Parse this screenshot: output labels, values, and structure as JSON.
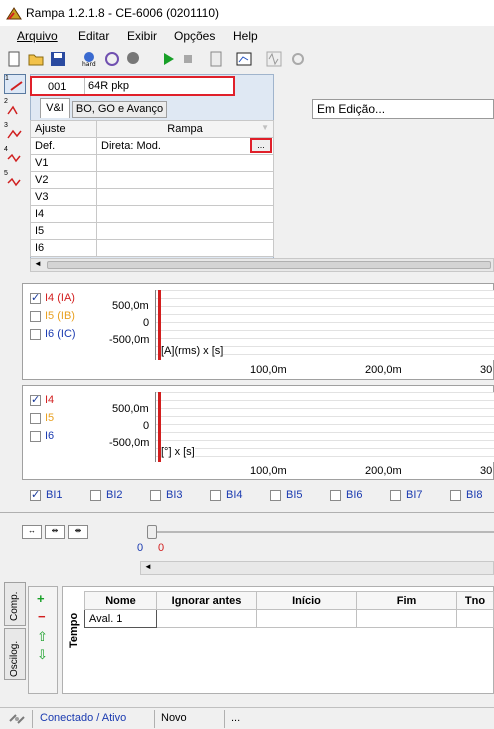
{
  "window": {
    "title": "Rampa 1.2.1.8 - CE-6006 (0201110)"
  },
  "menu": [
    "Arquivo",
    "Editar",
    "Exibir",
    "Opções",
    "Help"
  ],
  "toolbar": {
    "mode_combo": "Em Edição..."
  },
  "step_nav": [
    "1",
    "2",
    "3",
    "4",
    "5"
  ],
  "step": {
    "number": "001",
    "name": "64R pkp",
    "tabs": [
      "V&I",
      "BO, GO e Avanço"
    ]
  },
  "grid": {
    "col_ajuste": "Ajuste",
    "col_rampa": "Rampa",
    "rows": [
      {
        "name": "Def.",
        "value": "Direta: Mod."
      },
      {
        "name": "V1",
        "value": ""
      },
      {
        "name": "V2",
        "value": ""
      },
      {
        "name": "V3",
        "value": ""
      },
      {
        "name": "I4",
        "value": ""
      },
      {
        "name": "I5",
        "value": ""
      },
      {
        "name": "I6",
        "value": ""
      }
    ],
    "ellipsis": "..."
  },
  "plot1": {
    "series": [
      {
        "label": "I4 (IA)",
        "color": "#d21e1e",
        "checked": true
      },
      {
        "label": "I5 (IB)",
        "color": "#e8a020",
        "checked": false
      },
      {
        "label": "I6 (IC)",
        "color": "#1a3ab0",
        "checked": false
      }
    ],
    "y_ticks": [
      "500,0m",
      "0",
      "-500,0m"
    ],
    "unit": "[A](rms) x [s]",
    "x_ticks": [
      "100,0m",
      "200,0m",
      "30"
    ]
  },
  "plot2": {
    "series": [
      {
        "label": "I4",
        "color": "#d21e1e",
        "checked": true
      },
      {
        "label": "I5",
        "color": "#e8a020",
        "checked": false
      },
      {
        "label": "I6",
        "color": "#1a3ab0",
        "checked": false
      }
    ],
    "y_ticks": [
      "500,0m",
      "0",
      "-500,0m"
    ],
    "unit": "[°] x [s]",
    "x_ticks": [
      "100,0m",
      "200,0m",
      "30"
    ]
  },
  "binary_inputs": [
    {
      "label": "BI1",
      "checked": true
    },
    {
      "label": "BI2",
      "checked": false
    },
    {
      "label": "BI3",
      "checked": false
    },
    {
      "label": "BI4",
      "checked": false
    },
    {
      "label": "BI5",
      "checked": false
    },
    {
      "label": "BI6",
      "checked": false
    },
    {
      "label": "BI7",
      "checked": false
    },
    {
      "label": "BI8",
      "checked": false
    }
  ],
  "timeline": {
    "value_blue": "0",
    "value_red": "0"
  },
  "side_tabs": [
    "Comp.",
    "Oscilog."
  ],
  "tempo": {
    "title": "Tempo",
    "columns": [
      "Nome",
      "Ignorar antes",
      "Início",
      "Fim",
      "Tno"
    ],
    "rows": [
      [
        "Aval. 1",
        "",
        "",
        "",
        ""
      ]
    ]
  },
  "status": {
    "conn": "Conectado / Ativo",
    "state": "Novo",
    "extra": "..."
  }
}
